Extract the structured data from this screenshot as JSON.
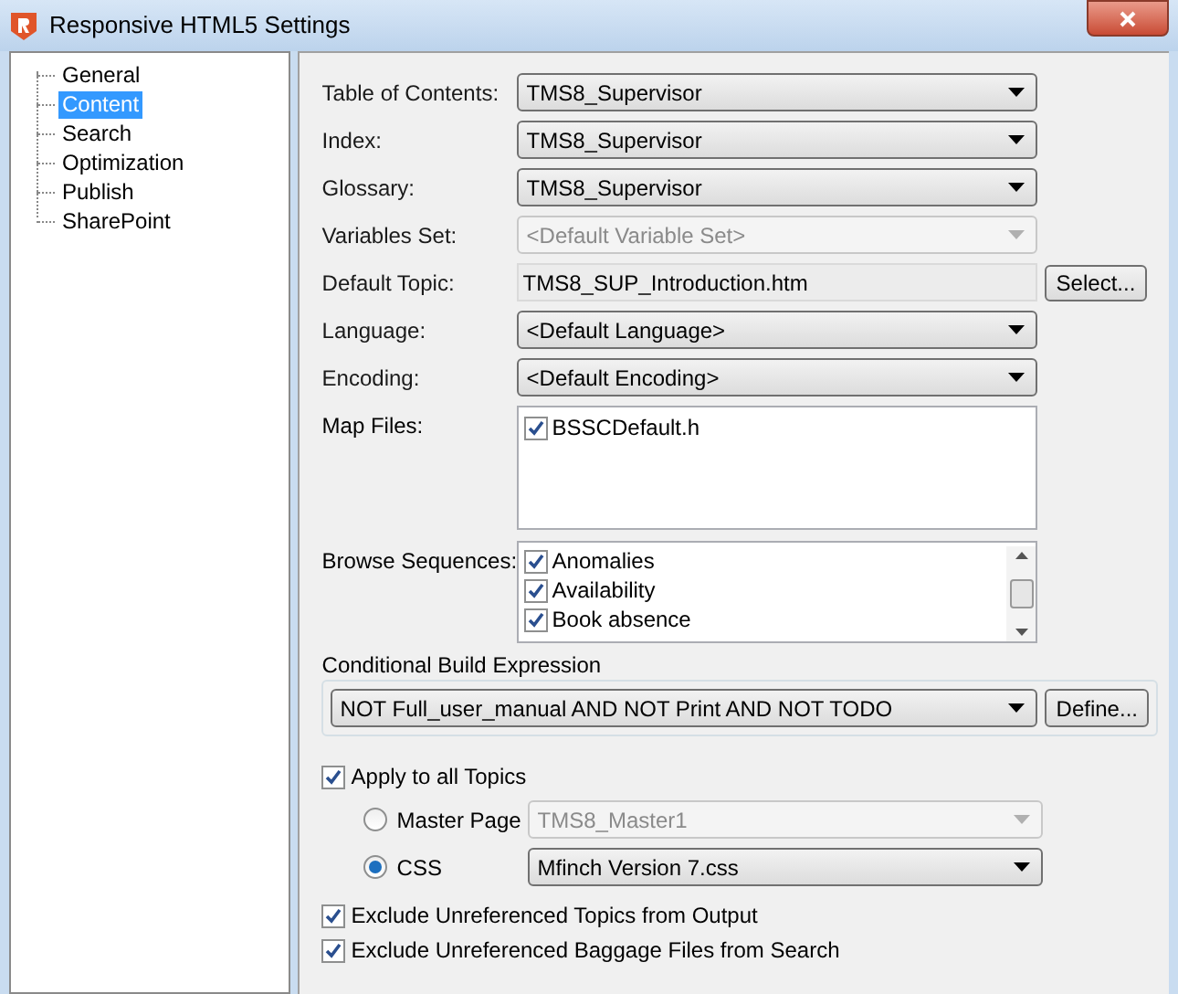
{
  "window": {
    "title": "Responsive HTML5 Settings"
  },
  "sidebar": {
    "items": [
      {
        "label": "General",
        "selected": false
      },
      {
        "label": "Content",
        "selected": true
      },
      {
        "label": "Search",
        "selected": false
      },
      {
        "label": "Optimization",
        "selected": false
      },
      {
        "label": "Publish",
        "selected": false
      },
      {
        "label": "SharePoint",
        "selected": false
      }
    ]
  },
  "fields": [
    {
      "kind": "dropdown",
      "label": "Table of Contents:",
      "value": "TMS8_Supervisor",
      "disabled": false
    },
    {
      "kind": "dropdown",
      "label": "Index:",
      "value": "TMS8_Supervisor",
      "disabled": false
    },
    {
      "kind": "dropdown",
      "label": "Glossary:",
      "value": "TMS8_Supervisor",
      "disabled": false
    },
    {
      "kind": "dropdown",
      "label": "Variables Set:",
      "value": "<Default Variable Set>",
      "disabled": true
    },
    {
      "kind": "text",
      "label": "Default Topic:",
      "value": "TMS8_SUP_Introduction.htm",
      "button": "Select..."
    },
    {
      "kind": "dropdown",
      "label": "Language:",
      "value": "<Default Language>",
      "disabled": false
    },
    {
      "kind": "dropdown",
      "label": "Encoding:",
      "value": "<Default Encoding>",
      "disabled": false
    }
  ],
  "map_files": {
    "label": "Map Files:",
    "items": [
      {
        "label": "BSSCDefault.h",
        "checked": true
      }
    ]
  },
  "browse_sequences": {
    "label": "Browse Sequences:",
    "items": [
      {
        "label": "Anomalies",
        "checked": true
      },
      {
        "label": "Availability",
        "checked": true
      },
      {
        "label": "Book absence",
        "checked": true
      }
    ]
  },
  "conditional_build": {
    "title": "Conditional Build Expression",
    "value": "NOT Full_user_manual AND NOT Print AND NOT TODO",
    "button": "Define..."
  },
  "apply_all": {
    "label": "Apply to all Topics",
    "checked": true
  },
  "template": [
    {
      "label": "Master Page",
      "selected": false,
      "value": "TMS8_Master1"
    },
    {
      "label": "CSS",
      "selected": true,
      "value": "Mfinch Version 7.css"
    }
  ],
  "options": [
    {
      "label": "Exclude Unreferenced Topics from Output",
      "checked": true
    },
    {
      "label": "Exclude Unreferenced Baggage Files from Search",
      "checked": true
    }
  ]
}
